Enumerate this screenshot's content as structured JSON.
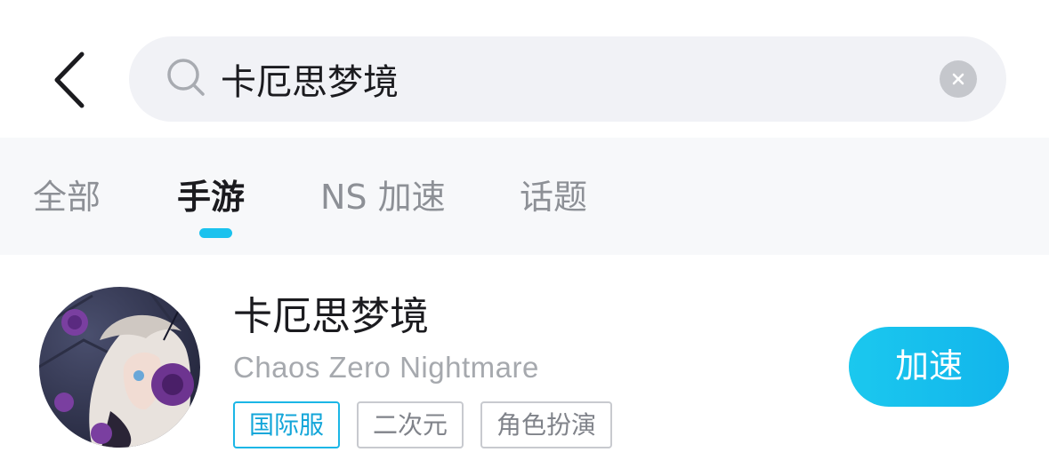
{
  "header": {
    "back_icon": "chevron-left-icon",
    "search": {
      "value": "卡厄思梦境",
      "icon": "search-icon",
      "clear_icon": "close-icon"
    }
  },
  "tabs": [
    {
      "label": "全部",
      "active": false
    },
    {
      "label": "手游",
      "active": true
    },
    {
      "label": "NS 加速",
      "active": false
    },
    {
      "label": "话题",
      "active": false
    }
  ],
  "result": {
    "title": "卡厄思梦境",
    "subtitle": "Chaos Zero Nightmare",
    "tags": [
      "国际服",
      "二次元",
      "角色扮演"
    ],
    "action_label": "加速"
  },
  "colors": {
    "accent": "#1bc2ee",
    "search_bg": "#f1f2f6",
    "tabs_bg": "#f7f8fa",
    "text_primary": "#1b1b1f",
    "text_secondary": "#a6a9ae"
  }
}
